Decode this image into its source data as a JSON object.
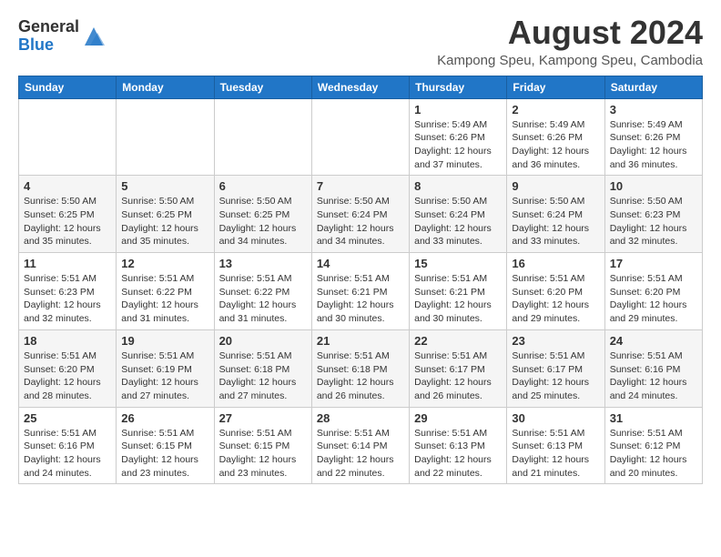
{
  "header": {
    "logo_general": "General",
    "logo_blue": "Blue",
    "title": "August 2024",
    "subtitle": "Kampong Speu, Kampong Speu, Cambodia"
  },
  "calendar": {
    "days_of_week": [
      "Sunday",
      "Monday",
      "Tuesday",
      "Wednesday",
      "Thursday",
      "Friday",
      "Saturday"
    ],
    "weeks": [
      [
        {
          "date": "",
          "info": ""
        },
        {
          "date": "",
          "info": ""
        },
        {
          "date": "",
          "info": ""
        },
        {
          "date": "",
          "info": ""
        },
        {
          "date": "1",
          "info": "Sunrise: 5:49 AM\nSunset: 6:26 PM\nDaylight: 12 hours\nand 37 minutes."
        },
        {
          "date": "2",
          "info": "Sunrise: 5:49 AM\nSunset: 6:26 PM\nDaylight: 12 hours\nand 36 minutes."
        },
        {
          "date": "3",
          "info": "Sunrise: 5:49 AM\nSunset: 6:26 PM\nDaylight: 12 hours\nand 36 minutes."
        }
      ],
      [
        {
          "date": "4",
          "info": "Sunrise: 5:50 AM\nSunset: 6:25 PM\nDaylight: 12 hours\nand 35 minutes."
        },
        {
          "date": "5",
          "info": "Sunrise: 5:50 AM\nSunset: 6:25 PM\nDaylight: 12 hours\nand 35 minutes."
        },
        {
          "date": "6",
          "info": "Sunrise: 5:50 AM\nSunset: 6:25 PM\nDaylight: 12 hours\nand 34 minutes."
        },
        {
          "date": "7",
          "info": "Sunrise: 5:50 AM\nSunset: 6:24 PM\nDaylight: 12 hours\nand 34 minutes."
        },
        {
          "date": "8",
          "info": "Sunrise: 5:50 AM\nSunset: 6:24 PM\nDaylight: 12 hours\nand 33 minutes."
        },
        {
          "date": "9",
          "info": "Sunrise: 5:50 AM\nSunset: 6:24 PM\nDaylight: 12 hours\nand 33 minutes."
        },
        {
          "date": "10",
          "info": "Sunrise: 5:50 AM\nSunset: 6:23 PM\nDaylight: 12 hours\nand 32 minutes."
        }
      ],
      [
        {
          "date": "11",
          "info": "Sunrise: 5:51 AM\nSunset: 6:23 PM\nDaylight: 12 hours\nand 32 minutes."
        },
        {
          "date": "12",
          "info": "Sunrise: 5:51 AM\nSunset: 6:22 PM\nDaylight: 12 hours\nand 31 minutes."
        },
        {
          "date": "13",
          "info": "Sunrise: 5:51 AM\nSunset: 6:22 PM\nDaylight: 12 hours\nand 31 minutes."
        },
        {
          "date": "14",
          "info": "Sunrise: 5:51 AM\nSunset: 6:21 PM\nDaylight: 12 hours\nand 30 minutes."
        },
        {
          "date": "15",
          "info": "Sunrise: 5:51 AM\nSunset: 6:21 PM\nDaylight: 12 hours\nand 30 minutes."
        },
        {
          "date": "16",
          "info": "Sunrise: 5:51 AM\nSunset: 6:20 PM\nDaylight: 12 hours\nand 29 minutes."
        },
        {
          "date": "17",
          "info": "Sunrise: 5:51 AM\nSunset: 6:20 PM\nDaylight: 12 hours\nand 29 minutes."
        }
      ],
      [
        {
          "date": "18",
          "info": "Sunrise: 5:51 AM\nSunset: 6:20 PM\nDaylight: 12 hours\nand 28 minutes."
        },
        {
          "date": "19",
          "info": "Sunrise: 5:51 AM\nSunset: 6:19 PM\nDaylight: 12 hours\nand 27 minutes."
        },
        {
          "date": "20",
          "info": "Sunrise: 5:51 AM\nSunset: 6:18 PM\nDaylight: 12 hours\nand 27 minutes."
        },
        {
          "date": "21",
          "info": "Sunrise: 5:51 AM\nSunset: 6:18 PM\nDaylight: 12 hours\nand 26 minutes."
        },
        {
          "date": "22",
          "info": "Sunrise: 5:51 AM\nSunset: 6:17 PM\nDaylight: 12 hours\nand 26 minutes."
        },
        {
          "date": "23",
          "info": "Sunrise: 5:51 AM\nSunset: 6:17 PM\nDaylight: 12 hours\nand 25 minutes."
        },
        {
          "date": "24",
          "info": "Sunrise: 5:51 AM\nSunset: 6:16 PM\nDaylight: 12 hours\nand 24 minutes."
        }
      ],
      [
        {
          "date": "25",
          "info": "Sunrise: 5:51 AM\nSunset: 6:16 PM\nDaylight: 12 hours\nand 24 minutes."
        },
        {
          "date": "26",
          "info": "Sunrise: 5:51 AM\nSunset: 6:15 PM\nDaylight: 12 hours\nand 23 minutes."
        },
        {
          "date": "27",
          "info": "Sunrise: 5:51 AM\nSunset: 6:15 PM\nDaylight: 12 hours\nand 23 minutes."
        },
        {
          "date": "28",
          "info": "Sunrise: 5:51 AM\nSunset: 6:14 PM\nDaylight: 12 hours\nand 22 minutes."
        },
        {
          "date": "29",
          "info": "Sunrise: 5:51 AM\nSunset: 6:13 PM\nDaylight: 12 hours\nand 22 minutes."
        },
        {
          "date": "30",
          "info": "Sunrise: 5:51 AM\nSunset: 6:13 PM\nDaylight: 12 hours\nand 21 minutes."
        },
        {
          "date": "31",
          "info": "Sunrise: 5:51 AM\nSunset: 6:12 PM\nDaylight: 12 hours\nand 20 minutes."
        }
      ]
    ]
  }
}
